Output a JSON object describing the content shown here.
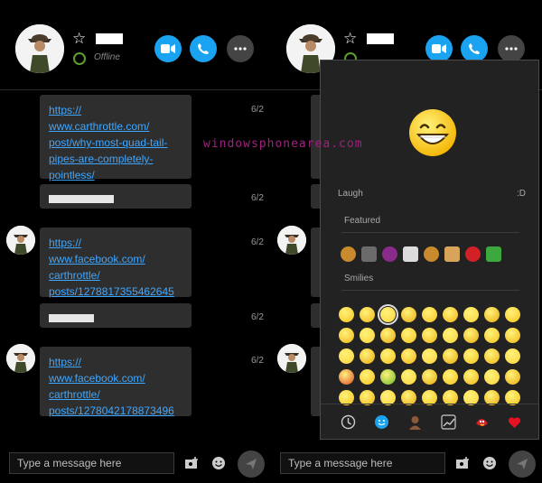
{
  "contact": {
    "status": "Offline"
  },
  "messages": [
    {
      "link": "https://\nwww.carthrottle.com/\npost/why-most-quad-tail-\npipes-are-completely-\npointless/",
      "time": "6/2"
    },
    {
      "time": "6/2"
    },
    {
      "link": "https://\nwww.facebook.com/\ncarthrottle/\nposts/1278817355462645",
      "time": "6/2"
    },
    {
      "time": "6/2"
    },
    {
      "link": "https://\nwww.facebook.com/\ncarthrottle/\nposts/1278042178873496",
      "time": "6/2"
    }
  ],
  "composer": {
    "placeholder": "Type a message here"
  },
  "emoji_panel": {
    "preview_label": "Laugh",
    "preview_shortcut": ":D",
    "featured_label": "Featured",
    "smilies_label": "Smilies",
    "tabs": [
      "clock-icon",
      "smiley-icon",
      "person-icon",
      "chart-icon",
      "bird-icon",
      "heart-icon"
    ]
  },
  "watermark": "windowsphonearea.com",
  "colors": {
    "accent": "#1aa3f0",
    "link": "#3fa7ff",
    "presence": "#5c9e31",
    "heart": "#e81123"
  }
}
